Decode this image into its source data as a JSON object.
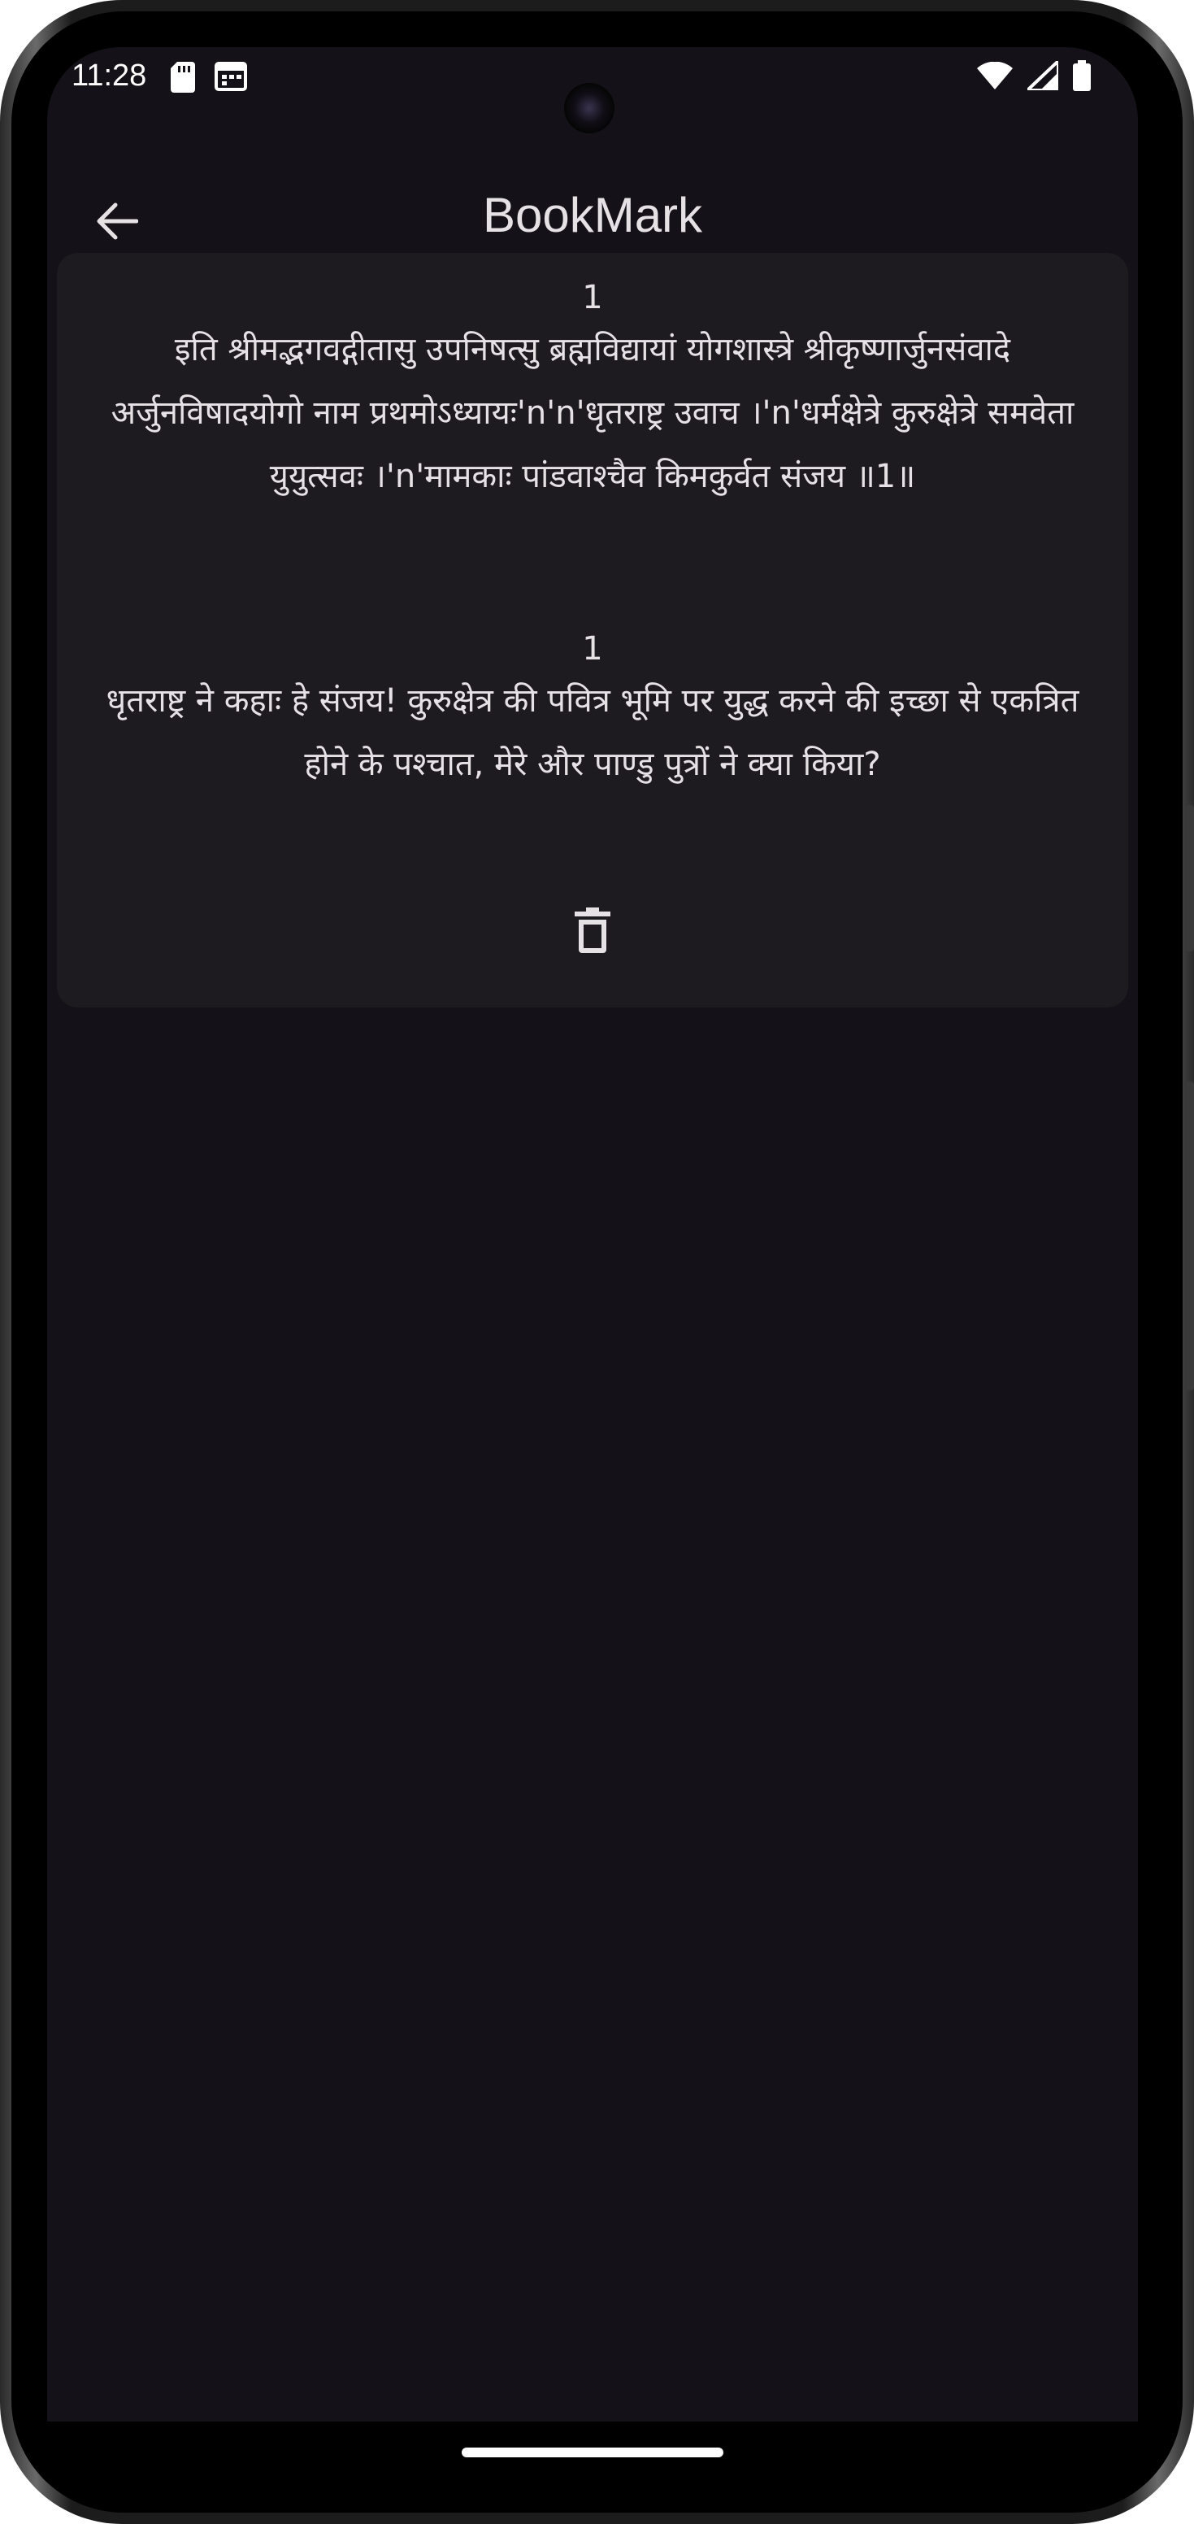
{
  "status_bar": {
    "time": "11:28",
    "left_icons": [
      "sd-card-icon",
      "calendar-icon"
    ],
    "right_icons": [
      "wifi-icon",
      "signal-icon",
      "battery-icon"
    ]
  },
  "app_bar": {
    "title": "BookMark",
    "back_icon": "arrow-left-icon"
  },
  "bookmarks": [
    {
      "sanskrit_number": "1",
      "sanskrit_text": "इति श्रीमद्भगवद्गीतासु उपनिषत्सु ब्रह्मविद्यायां योगशास्त्रे श्रीकृष्णार्जुनसंवादे अर्जुनविषादयोगो नाम प्रथमोऽध्यायः'n'n'धृतराष्ट्र उवाच ।'n'धर्मक्षेत्रे कुरुक्षेत्रे समवेता युयुत्सवः ।'n'मामकाः पांडवाश्चैव किमकुर्वत संजय ॥1॥",
      "translation_number": "1",
      "translation_text": "धृतराष्ट्र ने कहाः हे संजय! कुरुक्षेत्र की पवित्र भूमि पर युद्ध करने की इच्छा से एकत्रित होने के पश्चात, मेरे और पाण्डु पुत्रों ने क्या किया?",
      "delete_icon": "trash-icon"
    }
  ],
  "colors": {
    "background": "#141218",
    "card": "#1d1b20",
    "text": "#e6e1e5"
  }
}
